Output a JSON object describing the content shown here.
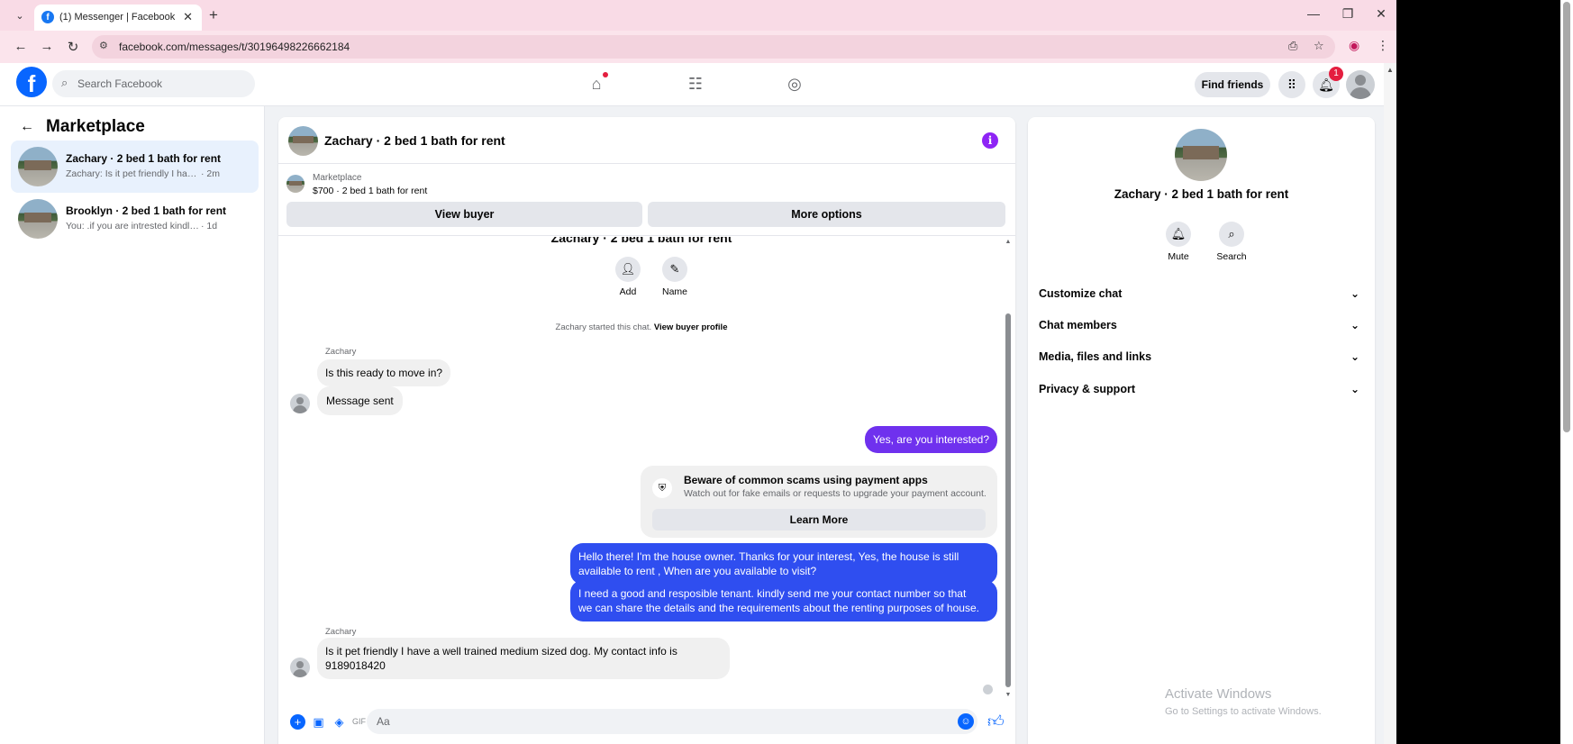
{
  "browser": {
    "tab_title": "(1) Messenger | Facebook",
    "url": "facebook.com/messages/t/30196498226662184"
  },
  "header": {
    "search_placeholder": "Search Facebook",
    "find_friends": "Find friends",
    "notification_count": "1"
  },
  "sidebar": {
    "title": "Marketplace",
    "conversations": [
      {
        "name": "Zachary · 2 bed 1 bath for rent",
        "preview": "Zachary: Is it pet friendly I have a well...",
        "time": "· 2m"
      },
      {
        "name": "Brooklyn · 2 bed 1 bath for rent",
        "preview": "You: .if you are intrested kindly send ...",
        "time": "· 1d"
      }
    ]
  },
  "chat": {
    "title": "Zachary · 2 bed 1 bath for rent",
    "marketplace_label": "Marketplace",
    "listing": "$700 · 2 bed 1 bath for rent",
    "view_buyer": "View buyer",
    "more_options": "More options",
    "intro_title": "Zachary · 2 bed 1 bath for rent",
    "add_label": "Add",
    "name_label": "Name",
    "system_text": "Zachary started this chat.",
    "system_link": "View buyer profile",
    "sender1": "Zachary",
    "msg1": "Is this ready to move in?",
    "msg2": "Message sent",
    "msg3": "Yes, are you interested?",
    "scam_title": "Beware of common scams using payment apps",
    "scam_desc": "Watch out for fake emails or requests to upgrade your payment account.",
    "learn_more": "Learn More",
    "msg4_line1": "Hello there! I'm the house owner. Thanks for your interest, Yes, the house is still",
    "msg4_line2": "available to rent , When are you available to visit?",
    "msg5_line1": "I need a good and resposible tenant.  kindly send me your contact number so that",
    "msg5_line2": "we can share the details and the requirements about the renting purposes of house.",
    "sender2": "Zachary",
    "msg6_line1": "Is it pet friendly I have a well trained medium sized dog. My contact info is",
    "msg6_line2": "9189018420",
    "composer_placeholder": "Aa"
  },
  "details": {
    "title": "Zachary · 2 bed 1 bath for rent",
    "mute": "Mute",
    "search": "Search",
    "rows": [
      "Customize chat",
      "Chat members",
      "Media, files and links",
      "Privacy & support"
    ]
  },
  "watermark": {
    "line1": "Activate Windows",
    "line2": "Go to Settings to activate Windows."
  },
  "colors": {
    "accent": "#0866ff",
    "outgoing_bubble": "#2f4ef0",
    "outgoing_purple": "#6f31ee",
    "info_button": "#8e24f5"
  }
}
